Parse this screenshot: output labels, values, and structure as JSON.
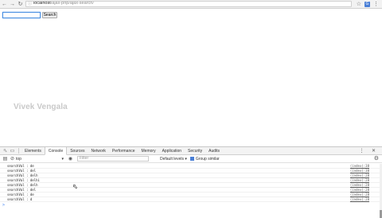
{
  "browser": {
    "url_host": "localhost",
    "url_path": "/ajax-php/ajax-search/",
    "extension_label": "G"
  },
  "page": {
    "search_button_label": "Search",
    "search_value": "",
    "watermark": "Vivek Vengala"
  },
  "devtools": {
    "tabs": [
      "Elements",
      "Console",
      "Sources",
      "Network",
      "Performance",
      "Memory",
      "Application",
      "Security",
      "Audits"
    ],
    "active_tab": "Console",
    "context": "top",
    "filter_placeholder": "Filter",
    "levels": "Default levels",
    "group_similar": "Group similar",
    "logs": [
      {
        "text": "searchVal : de",
        "src": "(index):38"
      },
      {
        "text": "searchVal : del",
        "src": "(index):38"
      },
      {
        "text": "searchVal : delh",
        "src": "(index):28"
      },
      {
        "text": "searchVal : delhi",
        "src": "(index):28"
      },
      {
        "text": "searchVal : delh",
        "src": "(index):28"
      },
      {
        "text": "searchVal : del",
        "src": "(index):28"
      },
      {
        "text": "searchVal : de",
        "src": "(index):28"
      },
      {
        "text": "searchVal : d",
        "src": "(index):28"
      }
    ],
    "prompt": ">"
  }
}
